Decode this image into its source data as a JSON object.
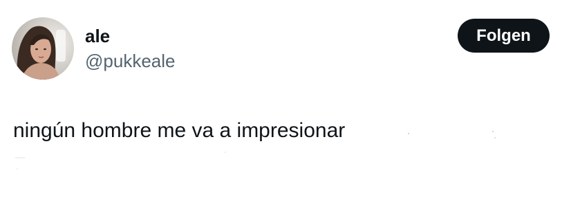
{
  "author": {
    "display_name": "ale",
    "handle": "@pukkeale"
  },
  "actions": {
    "follow_label": "Folgen"
  },
  "tweet": {
    "text": "ningún hombre me va a impresionar"
  },
  "colors": {
    "text_primary": "#0f1419",
    "text_secondary": "#536471",
    "button_bg": "#0f1419",
    "button_text": "#ffffff"
  }
}
